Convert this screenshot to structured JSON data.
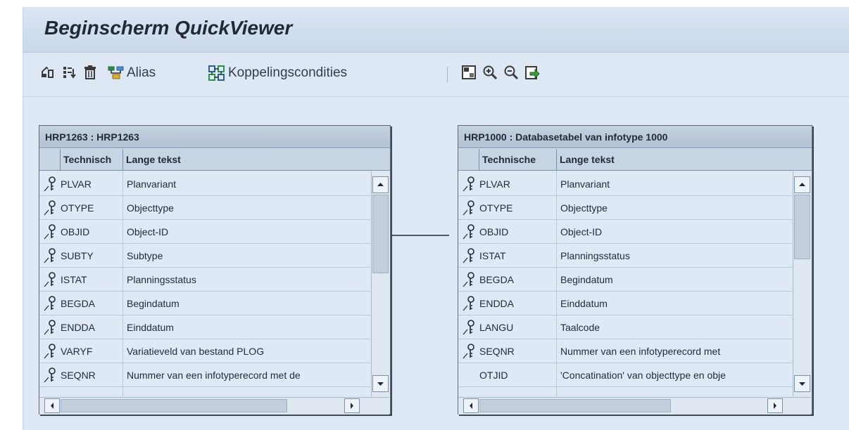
{
  "window": {
    "title": "Beginscherm QuickViewer"
  },
  "toolbar": {
    "icons": [
      "join-tables-icon",
      "sort-fields-icon",
      "delete-icon",
      "alias-icon",
      "join-conditions-icon",
      "overview-icon",
      "zoom-in-icon",
      "zoom-out-icon",
      "export-icon"
    ],
    "alias_label": "Alias",
    "join_label": "Koppelingscondities"
  },
  "left_table": {
    "header": "HRP1263 : HRP1263",
    "col_technical": "Technisch",
    "col_long_text": "Lange tekst",
    "rows": [
      {
        "name": "PLVAR",
        "desc": "Planvariant",
        "key": true
      },
      {
        "name": "OTYPE",
        "desc": "Objecttype",
        "key": true
      },
      {
        "name": "OBJID",
        "desc": "Object-ID",
        "key": true
      },
      {
        "name": "SUBTY",
        "desc": "Subtype",
        "key": true
      },
      {
        "name": "ISTAT",
        "desc": "Planningsstatus",
        "key": true
      },
      {
        "name": "BEGDA",
        "desc": "Begindatum",
        "key": true
      },
      {
        "name": "ENDDA",
        "desc": "Einddatum",
        "key": true
      },
      {
        "name": "VARYF",
        "desc": "Variatieveld van bestand PLOG",
        "key": true
      },
      {
        "name": "SEQNR",
        "desc": "Nummer van een infotyperecord met de",
        "key": true
      }
    ]
  },
  "right_table": {
    "header": "HRP1000 : Databasetabel van infotype 1000",
    "col_technical": "Technische",
    "col_long_text": "Lange tekst",
    "rows": [
      {
        "name": "PLVAR",
        "desc": "Planvariant",
        "key": true
      },
      {
        "name": "OTYPE",
        "desc": "Objecttype",
        "key": true
      },
      {
        "name": "OBJID",
        "desc": "Object-ID",
        "key": true
      },
      {
        "name": "ISTAT",
        "desc": "Planningsstatus",
        "key": true
      },
      {
        "name": "BEGDA",
        "desc": "Begindatum",
        "key": true
      },
      {
        "name": "ENDDA",
        "desc": "Einddatum",
        "key": true
      },
      {
        "name": "LANGU",
        "desc": "Taalcode",
        "key": true
      },
      {
        "name": "SEQNR",
        "desc": "Nummer van een infotyperecord met",
        "key": true
      },
      {
        "name": "OTJID",
        "desc": "'Concatination' van objecttype en obje",
        "key": false
      }
    ]
  },
  "join": {
    "from": "OBJID",
    "to": "OBJID"
  },
  "colors": {
    "background": "#dfe9f5",
    "title_bar": "#c9d8eb",
    "table_header": "#b4c3d5",
    "join_line": "#1f2a36"
  }
}
